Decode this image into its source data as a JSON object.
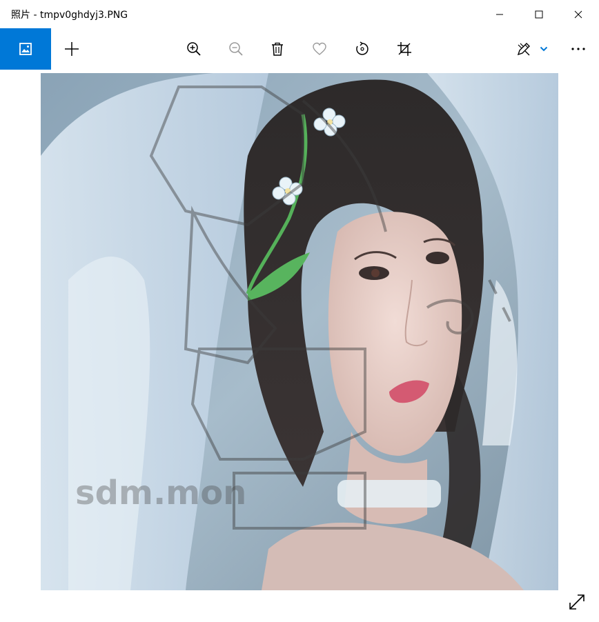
{
  "window": {
    "title": "照片 - tmpv0ghdyj3.PNG",
    "controls": [
      "minimize",
      "maximize",
      "close"
    ]
  },
  "toolbar": {
    "icons": [
      "photo-icon",
      "add-icon",
      "zoom-in-icon",
      "zoom-out-icon",
      "delete-icon",
      "heart-icon",
      "rotate-icon",
      "crop-icon",
      "edit-draw-icon",
      "chevron-down-icon",
      "more-icon"
    ],
    "accent": "#0078d7"
  },
  "viewer": {
    "image": {
      "subject": "woman with dark hair and flowers, white veil",
      "watermark_text": "sdm.mon"
    },
    "expand_icon": "expand-icon"
  }
}
